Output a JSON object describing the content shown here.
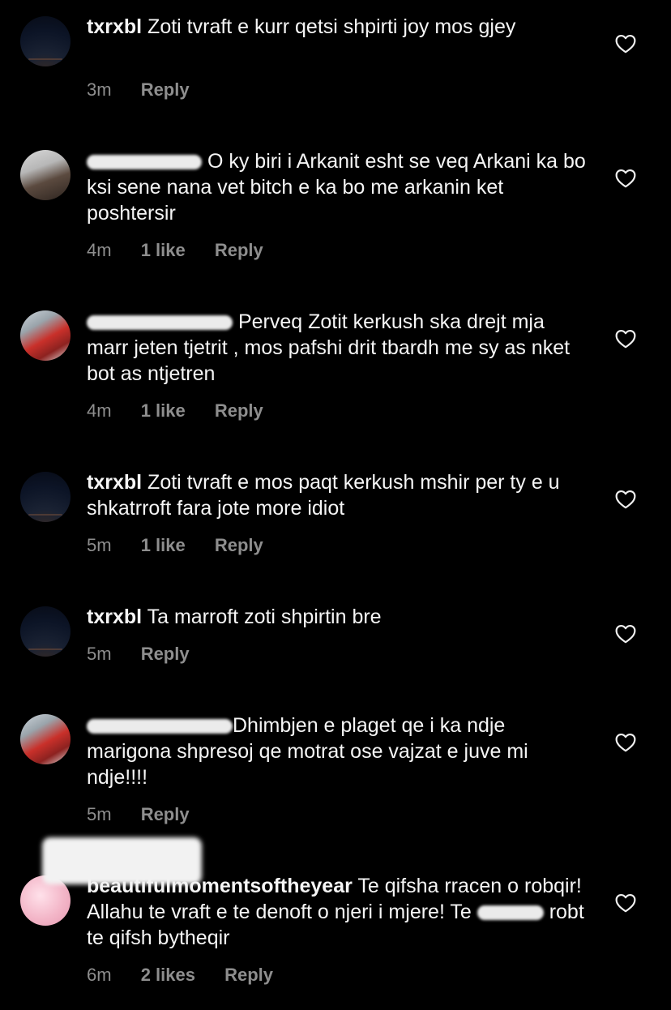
{
  "comments": [
    {
      "username": "txrxbl",
      "text": "Zoti tvraft e kurr qetsi shpirti joy mos gjey",
      "time": "3m",
      "likes": "",
      "reply": "Reply"
    },
    {
      "username": "",
      "text": "O ky biri i Arkanit esht se veq Arkani ka bo ksi sene nana vet bitch e ka bo me arkanin ket poshtersir",
      "time": "4m",
      "likes": "1 like",
      "reply": "Reply"
    },
    {
      "username": "",
      "text": "Perveq Zotit kerkush ska drejt mja marr jeten tjetrit , mos pafshi drit tbardh me sy as nket bot as ntjetren",
      "time": "4m",
      "likes": "1 like",
      "reply": "Reply"
    },
    {
      "username": "txrxbl",
      "text": "Zoti tvraft e mos paqt kerkush mshir per ty e u shkatrroft fara jote more idiot",
      "time": "5m",
      "likes": "1 like",
      "reply": "Reply"
    },
    {
      "username": "txrxbl",
      "text": "Ta marroft zoti shpirtin bre",
      "time": "5m",
      "likes": "",
      "reply": "Reply"
    },
    {
      "username": "",
      "text": "Dhimbjen e plaget qe i ka ndje marigona shpresoj qe motrat ose vajzat e juve mi ndje!!!!",
      "time": "5m",
      "likes": "",
      "reply": "Reply"
    },
    {
      "username": "beautifulmomentsoftheyear",
      "text_a": "Te qifsha rracen o robqir! Allahu te vraft e te denoft o njeri i mjere! Te",
      "text_b": "robt te qifsh bytheqir",
      "time": "6m",
      "likes": "2 likes",
      "reply": "Reply"
    }
  ],
  "icons": {
    "like": "heart-outline-icon"
  },
  "colors": {
    "background": "#000000",
    "text": "#f5f5f5",
    "meta": "#8e8e8e"
  }
}
